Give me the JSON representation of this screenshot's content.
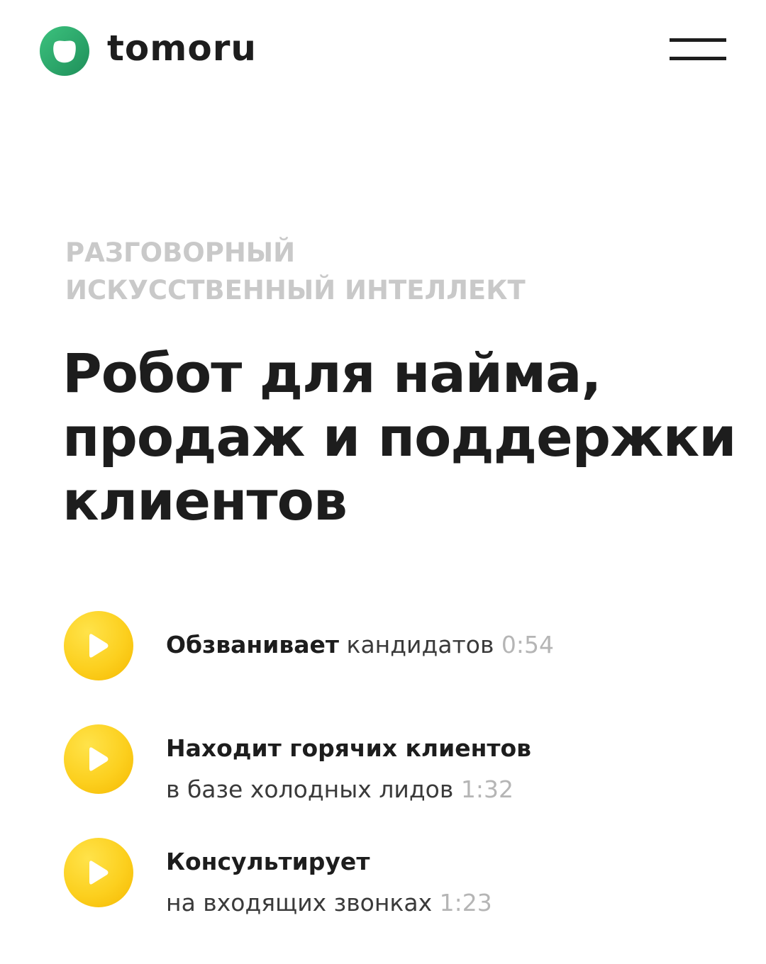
{
  "header": {
    "brand": "tomoru",
    "logo_color": "#2bb673",
    "menu_icon": "hamburger-menu-icon"
  },
  "hero": {
    "eyebrow_line1": "РАЗГОВОРНЫЙ",
    "eyebrow_line2": "ИСКУССТВЕННЫЙ ИНТЕЛЛЕКТ",
    "title_line1": "Робот для найма,",
    "title_line2": "продаж и поддержки",
    "title_line3": "клиентов"
  },
  "features": [
    {
      "icon": "play-icon",
      "bold": "Обзванивает",
      "rest": "кандидатов",
      "duration": "0:54"
    },
    {
      "icon": "play-icon",
      "bold": "Находит горячих клиентов",
      "rest": "в базе холодных лидов",
      "duration": "1:32"
    },
    {
      "icon": "play-icon",
      "bold": "Консультирует",
      "rest": "на входящих звонках",
      "duration": "1:23"
    }
  ],
  "colors": {
    "accent_yellow": "#fcd01f",
    "text_dark": "#1d1d1d",
    "eyebrow_grey": "#c9c9c9",
    "duration_grey": "#b5b5b5"
  }
}
